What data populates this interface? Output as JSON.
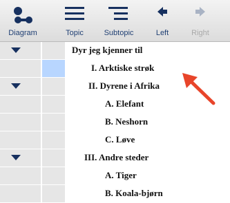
{
  "toolbar": {
    "buttons": [
      {
        "label": "Diagram",
        "icon": "diagram-icon",
        "enabled": true
      },
      {
        "label": "Topic",
        "icon": "topic-icon",
        "enabled": true
      },
      {
        "label": "Subtopic",
        "icon": "subtopic-icon",
        "enabled": true
      },
      {
        "label": "Left",
        "icon": "left-arrow-icon",
        "enabled": true
      },
      {
        "label": "Right",
        "icon": "right-arrow-icon",
        "enabled": false
      }
    ]
  },
  "outline": {
    "rows": [
      {
        "text": "Dyr jeg kjenner til",
        "expanded": true
      },
      {
        "text": "I. Arktiske strøk",
        "selected": true
      },
      {
        "text": "II. Dyrene i Afrika",
        "expanded": true
      },
      {
        "text": "A. Elefant"
      },
      {
        "text": "B. Neshorn"
      },
      {
        "text": "C. Løve"
      },
      {
        "text": "III. Andre steder",
        "expanded": true
      },
      {
        "text": "A. Tiger"
      },
      {
        "text": "B. Koala-bjørn"
      }
    ]
  },
  "colors": {
    "toolbar_icon": "#16305f",
    "selection": "#b8d6ff",
    "annotation_arrow": "#e8452a"
  }
}
